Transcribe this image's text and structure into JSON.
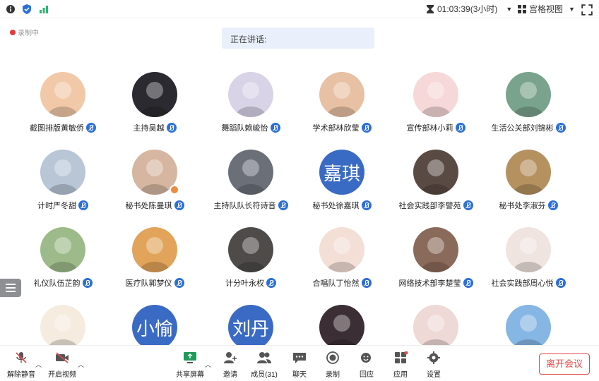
{
  "topbar": {
    "timer": "01:03:39(3小时)",
    "view_label": "宫格视图"
  },
  "recording_label": "录制中",
  "speaking": {
    "label": "正在讲话:"
  },
  "participants": [
    {
      "name": "截图排版黄敏侨",
      "avatar_text": "",
      "avatar_color": "#f2c9a8"
    },
    {
      "name": "主持吴越",
      "avatar_text": "",
      "avatar_color": "#2a2a30"
    },
    {
      "name": "舞蹈队赖峻怡",
      "avatar_text": "",
      "avatar_color": "#d9d3e8"
    },
    {
      "name": "学术部林欣莹",
      "avatar_text": "",
      "avatar_color": "#e8c0a4"
    },
    {
      "name": "宣传部林小莉",
      "avatar_text": "",
      "avatar_color": "#f7d8d8"
    },
    {
      "name": "生活公关部刘锦彬",
      "avatar_text": "",
      "avatar_color": "#7aa38d"
    },
    {
      "name": "计时严冬甜",
      "avatar_text": "",
      "avatar_color": "#b8c6d6"
    },
    {
      "name": "秘书处陈曼琪",
      "avatar_text": "",
      "avatar_color": "#d6b6a0"
    },
    {
      "name": "主持队队长符诗音",
      "avatar_text": "",
      "avatar_color": "#6b6f78"
    },
    {
      "name": "秘书处徐嘉琪",
      "avatar_text": "嘉琪",
      "avatar_color": "#3a6bc4"
    },
    {
      "name": "社会实践部李譬苑",
      "avatar_text": "",
      "avatar_color": "#5a4a44"
    },
    {
      "name": "秘书处李淑芬",
      "avatar_text": "",
      "avatar_color": "#b5915f"
    },
    {
      "name": "礼仪队伍芷韵",
      "avatar_text": "",
      "avatar_color": "#9dbb8a"
    },
    {
      "name": "医疗队郭梦仪",
      "avatar_text": "",
      "avatar_color": "#e2a35a"
    },
    {
      "name": "计分叶永权",
      "avatar_text": "",
      "avatar_color": "#4e4b48"
    },
    {
      "name": "合唱队丁怡然",
      "avatar_text": "",
      "avatar_color": "#f3dfd6"
    },
    {
      "name": "网络技术部李楚莹",
      "avatar_text": "",
      "avatar_color": "#8a6a5a"
    },
    {
      "name": "社会实践部周心悦",
      "avatar_text": "",
      "avatar_color": "#f0e4e0"
    },
    {
      "name": "",
      "avatar_text": "",
      "avatar_color": "#f5ecdf"
    },
    {
      "name": "",
      "avatar_text": "小愉",
      "avatar_color": "#3a6bc4"
    },
    {
      "name": "",
      "avatar_text": "刘丹",
      "avatar_color": "#3a6bc4"
    },
    {
      "name": "",
      "avatar_text": "",
      "avatar_color": "#3b2e34"
    },
    {
      "name": "",
      "avatar_text": "",
      "avatar_color": "#eed9d6"
    },
    {
      "name": "",
      "avatar_text": "",
      "avatar_color": "#86b6e4"
    }
  ],
  "toolbar": {
    "unmute": "解除静音",
    "start_video": "开启视频",
    "share_screen": "共享屏幕",
    "invite": "邀请",
    "members": "成员(31)",
    "chat": "聊天",
    "record": "录制",
    "reactions": "回应",
    "apps": "应用",
    "settings": "设置",
    "leave": "离开会议"
  },
  "colors": {
    "accent": "#2c6fd8",
    "danger": "#e24b4b",
    "avatar_blue": "#3a6bc4"
  }
}
